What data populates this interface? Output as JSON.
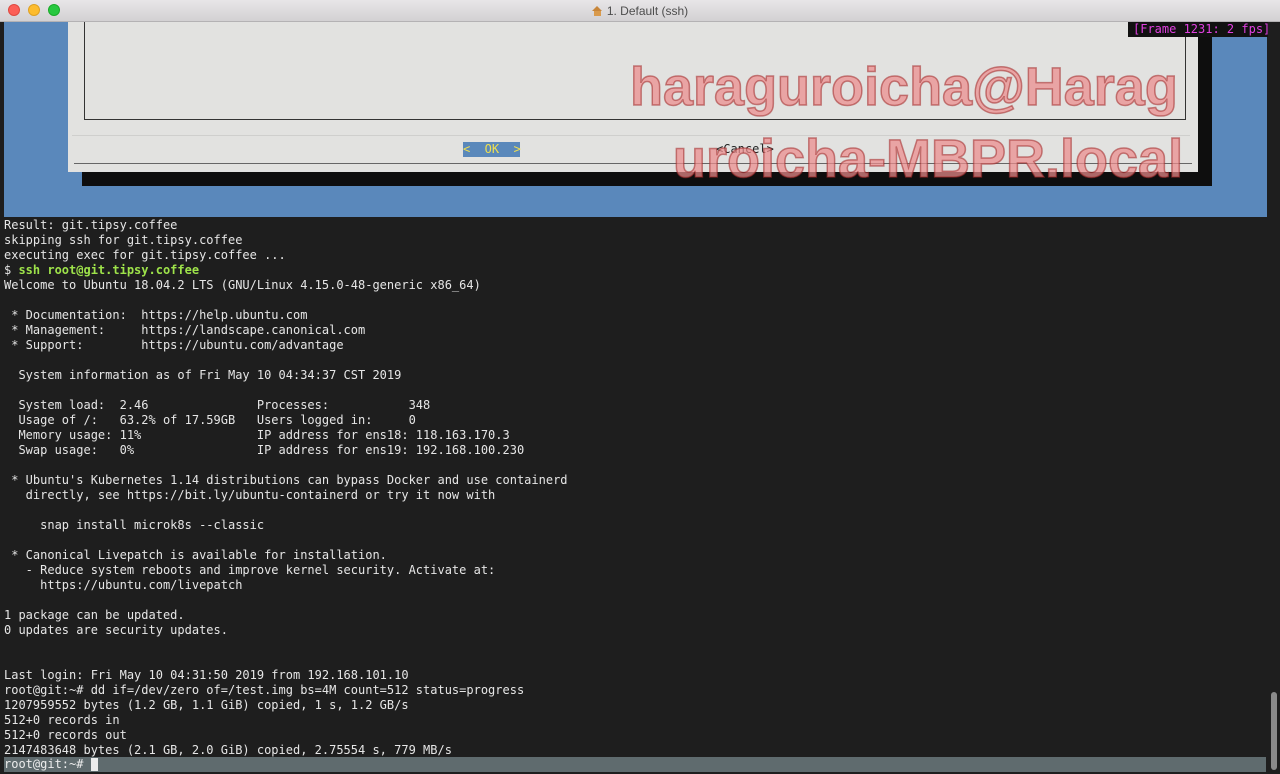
{
  "window": {
    "title": "1. Default (ssh)"
  },
  "dialog": {
    "ok_label": "<  OK  >",
    "cancel_label": "<Cancel>"
  },
  "frame_counter": "[Frame 1231: 2 fps]",
  "watermark": {
    "line1": "haraguroicha@Harag",
    "line2": "uroicha-MBPR.local"
  },
  "terminal": {
    "lines": [
      {
        "text": "Result: git.tipsy.coffee"
      },
      {
        "text": "skipping ssh for git.tipsy.coffee"
      },
      {
        "text": "executing exec for git.tipsy.coffee ..."
      },
      {
        "prompt": "$ ",
        "command": "ssh root@git.tipsy.coffee"
      },
      {
        "text": "Welcome to Ubuntu 18.04.2 LTS (GNU/Linux 4.15.0-48-generic x86_64)"
      },
      {
        "text": ""
      },
      {
        "text": " * Documentation:  https://help.ubuntu.com"
      },
      {
        "text": " * Management:     https://landscape.canonical.com"
      },
      {
        "text": " * Support:        https://ubuntu.com/advantage"
      },
      {
        "text": ""
      },
      {
        "text": "  System information as of Fri May 10 04:34:37 CST 2019"
      },
      {
        "text": ""
      },
      {
        "text": "  System load:  2.46               Processes:           348"
      },
      {
        "text": "  Usage of /:   63.2% of 17.59GB   Users logged in:     0"
      },
      {
        "text": "  Memory usage: 11%                IP address for ens18: 118.163.170.3"
      },
      {
        "text": "  Swap usage:   0%                 IP address for ens19: 192.168.100.230"
      },
      {
        "text": ""
      },
      {
        "text": " * Ubuntu's Kubernetes 1.14 distributions can bypass Docker and use containerd"
      },
      {
        "text": "   directly, see https://bit.ly/ubuntu-containerd or try it now with"
      },
      {
        "text": ""
      },
      {
        "text": "     snap install microk8s --classic"
      },
      {
        "text": ""
      },
      {
        "text": " * Canonical Livepatch is available for installation."
      },
      {
        "text": "   - Reduce system reboots and improve kernel security. Activate at:"
      },
      {
        "text": "     https://ubuntu.com/livepatch"
      },
      {
        "text": ""
      },
      {
        "text": "1 package can be updated."
      },
      {
        "text": "0 updates are security updates."
      },
      {
        "text": ""
      },
      {
        "text": ""
      },
      {
        "text": "Last login: Fri May 10 04:31:50 2019 from 192.168.101.10"
      },
      {
        "text": "root@git:~# dd if=/dev/zero of=/test.img bs=4M count=512 status=progress"
      },
      {
        "text": "1207959552 bytes (1.2 GB, 1.1 GiB) copied, 1 s, 1.2 GB/s"
      },
      {
        "text": "512+0 records in"
      },
      {
        "text": "512+0 records out"
      },
      {
        "text": "2147483648 bytes (2.1 GB, 2.0 GiB) copied, 2.75554 s, 779 MB/s"
      }
    ],
    "current_prompt": "root@git:~# "
  }
}
